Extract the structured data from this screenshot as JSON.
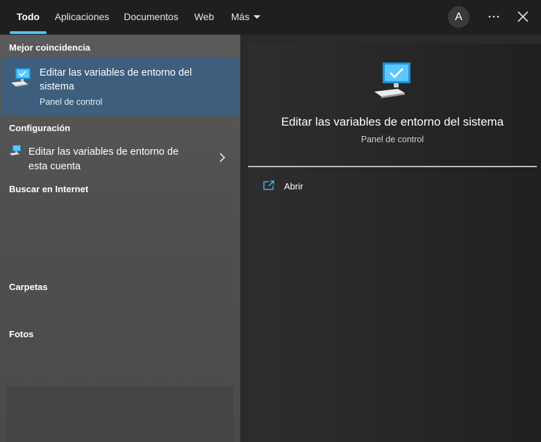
{
  "tabs": [
    {
      "label": "Todo",
      "active": true
    },
    {
      "label": "Aplicaciones"
    },
    {
      "label": "Documentos"
    },
    {
      "label": "Web"
    },
    {
      "label": "Más"
    }
  ],
  "header": {
    "avatar_initial": "A",
    "more_icon": "more-horizontal-icon",
    "close_icon": "close-icon"
  },
  "sections": {
    "best_match": "Mejor coincidencia",
    "settings": "Configuración",
    "web": "Buscar en Internet",
    "folders": "Carpetas",
    "photos": "Fotos"
  },
  "best_match_item": {
    "title": "Editar las variables de entorno del sistema",
    "subtitle": "Panel de control",
    "icon": "computer-check-icon"
  },
  "settings_item": {
    "title": "Editar las variables de entorno de esta cuenta",
    "icon": "computer-icon"
  },
  "preview": {
    "title": "Editar las variables de entorno del sistema",
    "subtitle": "Panel de control",
    "icon": "computer-check-icon",
    "actions": [
      {
        "label": "Abrir",
        "icon": "open-external-icon"
      }
    ]
  },
  "colors": {
    "accent": "#4cc2ff",
    "selected_item": "#3d5e7c"
  }
}
